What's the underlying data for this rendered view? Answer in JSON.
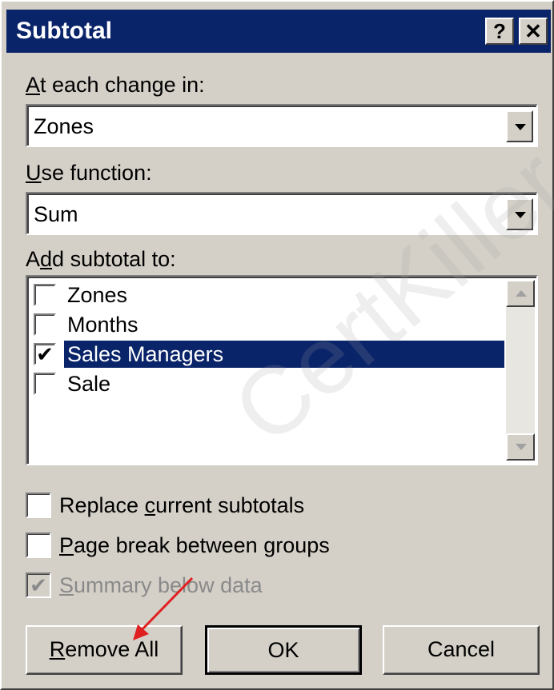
{
  "dialog": {
    "title": "Subtotal",
    "help_label": "?",
    "close_label": "✕"
  },
  "change_in": {
    "label_mnemonic": "A",
    "label_rest": "t each change in:",
    "value": "Zones"
  },
  "use_function": {
    "label_mnemonic": "U",
    "label_rest": "se function:",
    "value": "Sum"
  },
  "add_subtotal": {
    "label_pre": "A",
    "label_mnemonic": "d",
    "label_rest": "d subtotal to:",
    "items": [
      {
        "label": "Zones",
        "checked": false,
        "mark": ""
      },
      {
        "label": "Months",
        "checked": false,
        "mark": ""
      },
      {
        "label": "Sales Managers",
        "checked": true,
        "mark": "✔"
      },
      {
        "label": "Sale",
        "checked": false,
        "mark": ""
      }
    ]
  },
  "options": {
    "replace": {
      "pre": "Replace ",
      "mnemonic": "c",
      "rest": "urrent subtotals",
      "checked": false,
      "mark": ""
    },
    "page_break": {
      "pre": "",
      "mnemonic": "P",
      "rest": "age break between groups",
      "checked": false,
      "mark": ""
    },
    "summary": {
      "pre": "",
      "mnemonic": "S",
      "rest": "ummary below data",
      "checked": true,
      "mark": "✔"
    }
  },
  "buttons": {
    "remove_all_mnemonic": "R",
    "remove_all_rest": "emove All",
    "ok": "OK",
    "cancel": "Cancel"
  },
  "watermark": "CertKiller",
  "colors": {
    "titlebar": "#0a246a",
    "face": "#d4d0c8",
    "selection": "#0a246a",
    "annotation_arrow": "#e02020"
  }
}
